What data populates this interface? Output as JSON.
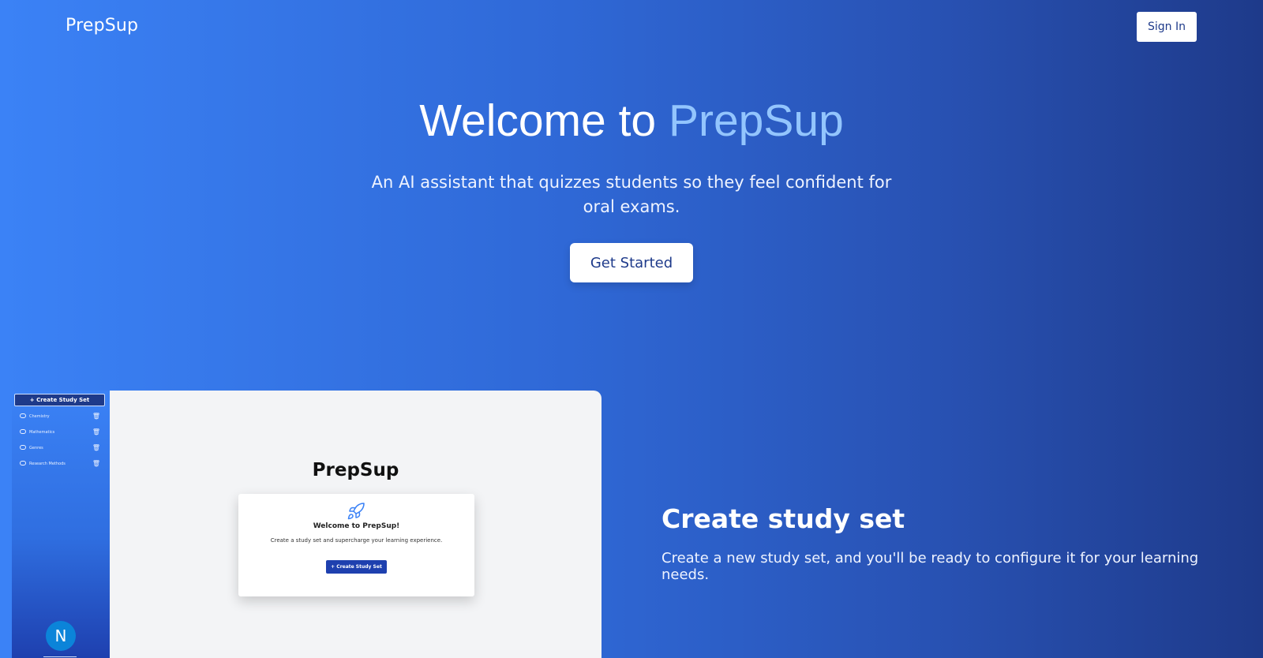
{
  "header": {
    "brand": "PrepSup",
    "sign_in_label": "Sign In"
  },
  "hero": {
    "title_prefix": "Welcome to",
    "title_accent": "PrepSup",
    "subtitle": "An AI assistant that quizzes students so they feel confident for oral exams.",
    "cta_label": "Get Started"
  },
  "preview": {
    "create_button_label": "Create Study Set",
    "sidebar_items": [
      {
        "label": "Chemistry",
        "icon": "chat-icon",
        "action_icon": "trash-icon"
      },
      {
        "label": "Mathematics",
        "icon": "chat-icon",
        "action_icon": "trash-icon"
      },
      {
        "label": "Genres",
        "icon": "chat-icon",
        "action_icon": "trash-icon"
      },
      {
        "label": "Research Methods",
        "icon": "chat-icon",
        "action_icon": "trash-icon"
      }
    ],
    "avatar_initial": "N",
    "main_title": "PrepSup",
    "card": {
      "icon": "rocket-icon",
      "heading": "Welcome to PrepSup!",
      "description": "Create a study set and supercharge your learning experience.",
      "button_label": "Create Study Set"
    }
  },
  "feature": {
    "title": "Create study set",
    "description": "Create a new study set, and you'll be ready to configure it for your learning needs."
  },
  "colors": {
    "gradient_start": "#3b82f6",
    "gradient_end": "#1e3a8a",
    "accent": "#93c5fd"
  }
}
